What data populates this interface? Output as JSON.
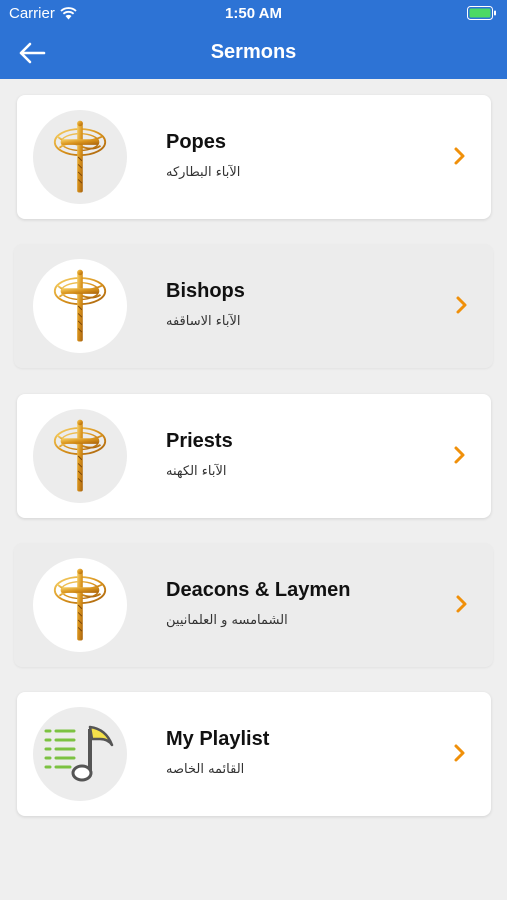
{
  "status_bar": {
    "carrier": "Carrier",
    "time": "1:50 AM"
  },
  "nav": {
    "title": "Sermons",
    "back_icon": "arrow-left-icon"
  },
  "colors": {
    "header": "#2d73d5",
    "accent_chevron": "#f0900a",
    "background": "#efefef"
  },
  "items": [
    {
      "title": "Popes",
      "subtitle": "الآباء البطاركه",
      "icon": "cross-icon"
    },
    {
      "title": "Bishops",
      "subtitle": "الآباء الاساقفه",
      "icon": "cross-icon"
    },
    {
      "title": "Priests",
      "subtitle": "الآباء الكهنه",
      "icon": "cross-icon"
    },
    {
      "title": "Deacons & Laymen",
      "subtitle": "الشمامسه و العلمانيين",
      "icon": "cross-icon"
    },
    {
      "title": "My Playlist",
      "subtitle": "القائمه الخاصه",
      "icon": "music-playlist-icon"
    }
  ]
}
